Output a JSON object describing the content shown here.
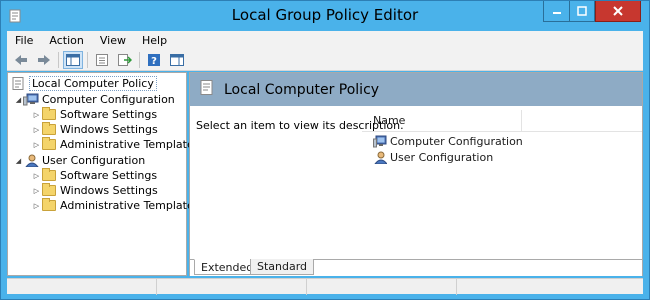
{
  "window": {
    "title": "Local Group Policy Editor",
    "icon": "policy-document-icon"
  },
  "menu": [
    "File",
    "Action",
    "View",
    "Help"
  ],
  "toolbar": {
    "icons": [
      "back-arrow-icon",
      "forward-arrow-icon",
      "show-hide-console-tree-icon",
      "properties-icon",
      "export-list-icon",
      "help-icon",
      "show-action-pane-icon"
    ]
  },
  "tree": {
    "root": "Local Computer Policy",
    "computer": {
      "label": "Computer Configuration",
      "children": [
        "Software Settings",
        "Windows Settings",
        "Administrative Templates"
      ]
    },
    "user": {
      "label": "User Configuration",
      "children": [
        "Software Settings",
        "Windows Settings",
        "Administrative Templates"
      ]
    }
  },
  "details": {
    "header": "Local Computer Policy",
    "description": "Select an item to view its description.",
    "column_name": "Name",
    "items": [
      "Computer Configuration",
      "User Configuration"
    ]
  },
  "tabs": [
    "Extended",
    "Standard"
  ],
  "colors": {
    "titlebar": "#4ab2ea",
    "close_button": "#c7372f",
    "header_band": "#8eabc5"
  }
}
